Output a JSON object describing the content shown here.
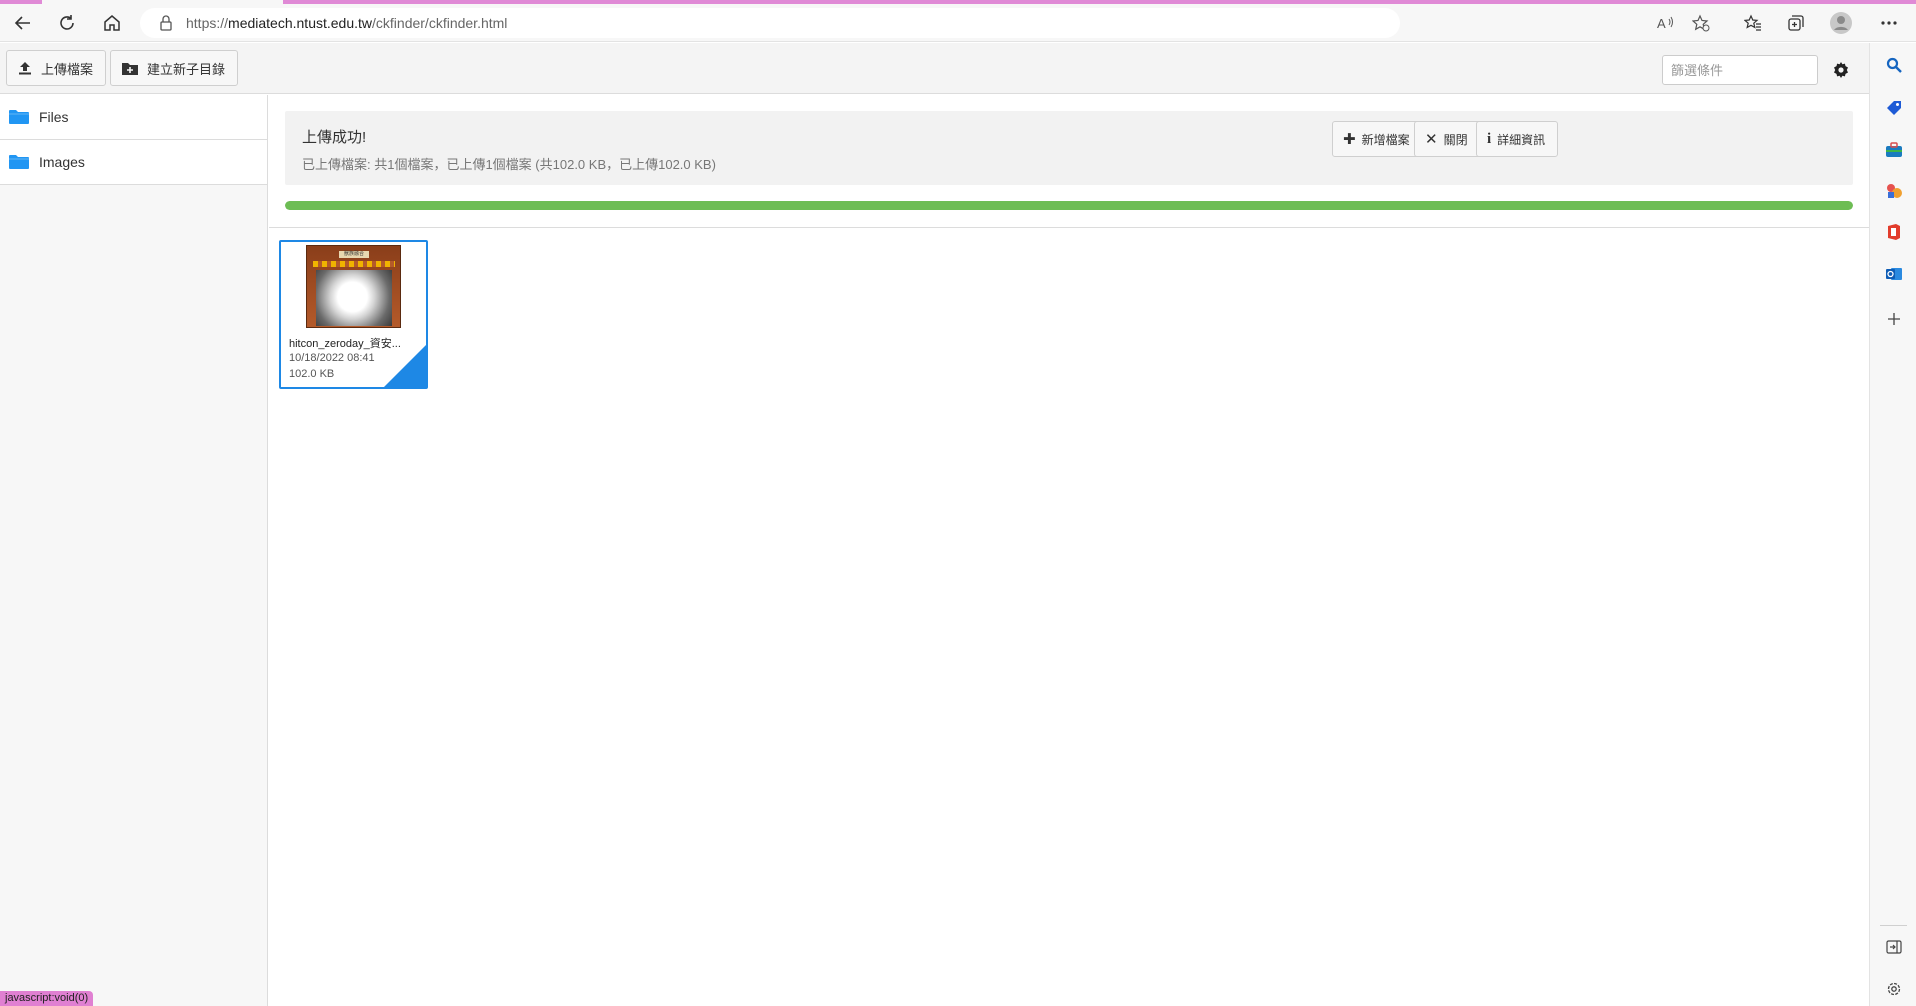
{
  "browser": {
    "url_prefix": "https://",
    "url_host": "mediatech.ntust.edu.tw",
    "url_path": "/ckfinder/ckfinder.html"
  },
  "toolbar": {
    "upload_label": "上傳檔案",
    "new_folder_label": "建立新子目錄",
    "filter_placeholder": "篩選條件"
  },
  "sidebar": {
    "folders": [
      {
        "label": "Files"
      },
      {
        "label": "Images"
      }
    ]
  },
  "upload_panel": {
    "title": "上傳成功!",
    "summary": "已上傳檔案: 共1個檔案，已上傳1個檔案 (共102.0 KB，已上傳102.0 KB)",
    "add_files_label": "新增檔案",
    "close_label": "關閉",
    "details_label": "詳細資訊",
    "progress": 1.0
  },
  "files": [
    {
      "name": "hitcon_zeroday_資安...",
      "date": "10/18/2022 08:41",
      "size": "102.0 KB",
      "thumb_title": "獸族融合"
    }
  ],
  "status_bar": {
    "text": "javascript:void(0)"
  },
  "colors": {
    "accent": "#1e88e5",
    "progress": "#6dbd54",
    "folder": "#2196f3",
    "status_tip": "#e080d2"
  }
}
